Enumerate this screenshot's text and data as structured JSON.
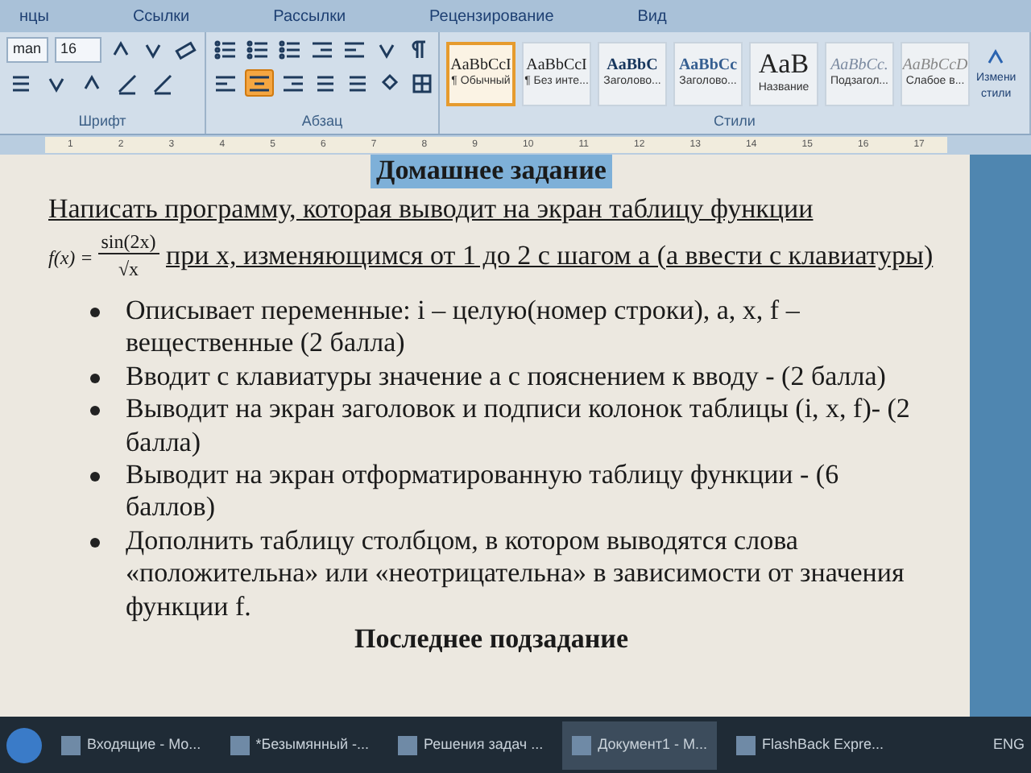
{
  "ribbon_tabs": [
    {
      "label": "нцы",
      "selected": false
    },
    {
      "label": "Ссылки",
      "selected": false
    },
    {
      "label": "Рассылки",
      "selected": false
    },
    {
      "label": "Рецензирование",
      "selected": false
    },
    {
      "label": "Вид",
      "selected": false
    }
  ],
  "font_group": {
    "font_name": "man",
    "font_size": "16",
    "label": "Шрифт"
  },
  "paragraph_group": {
    "label": "Абзац",
    "alignment_buttons": [
      {
        "selected": false
      },
      {
        "selected": true
      },
      {
        "selected": false
      },
      {
        "selected": false
      }
    ]
  },
  "styles_group": {
    "label": "Стили",
    "styles": [
      {
        "sample": "AaBbCcI",
        "name": "¶ Обычный",
        "selected": true,
        "kind": "normal"
      },
      {
        "sample": "AaBbCcI",
        "name": "¶ Без инте...",
        "selected": false,
        "kind": "normal"
      },
      {
        "sample": "AaBbC",
        "name": "Заголово...",
        "selected": false,
        "kind": "heading1"
      },
      {
        "sample": "AaBbCc",
        "name": "Заголово...",
        "selected": false,
        "kind": "heading2"
      },
      {
        "sample": "AaB",
        "name": "Название",
        "selected": false,
        "kind": "title"
      },
      {
        "sample": "AaBbCc.",
        "name": "Подзагол...",
        "selected": false,
        "kind": "subtitle"
      },
      {
        "sample": "AaBbCcD",
        "name": "Слабое в...",
        "selected": false,
        "kind": "subtle"
      }
    ],
    "change_styles": [
      "Измени",
      "стили"
    ]
  },
  "ruler": {
    "numbers": [
      "1",
      "2",
      "3",
      "4",
      "5",
      "6",
      "7",
      "8",
      "9",
      "10",
      "11",
      "12",
      "13",
      "14",
      "15",
      "16",
      "17"
    ]
  },
  "document": {
    "title": "Домашнее задание",
    "task": {
      "text": "Написать программу, которая выводит на экран  таблицу  функции",
      "underlined": true
    },
    "formula": {
      "lhs": "f(x) =",
      "numerator": "sin(2x)",
      "denominator": "√x"
    },
    "task_rest": "при x, изменяющимся от 1 до 2 с шагом a (а ввести с клавиатуры)",
    "bullets": [
      "Описывает переменные:  i – целую(номер строки),  a, x, f – вещественные  (2 балла)",
      "Вводит с клавиатуры значение a  с пояснением к вводу - (2 балла)",
      "Выводит на экран заголовок и подписи колонок таблицы (i, x, f)- (2 балла)",
      "Выводит на экран отформатированную таблицу функции  - (6 баллов)",
      "Дополнить таблицу столбцом, в котором выводятся слова «положительна» или «неотрицательна» в зависимости от значения функции f."
    ],
    "subheading": "Последнее подзадание"
  },
  "taskbar": {
    "items": [
      {
        "label": "Входящие - Mo...",
        "selected": false
      },
      {
        "label": "*Безымянный -...",
        "selected": false
      },
      {
        "label": "Решения задач ...",
        "selected": false
      },
      {
        "label": "Документ1 - M...",
        "selected": true
      },
      {
        "label": "FlashBack Expre...",
        "selected": false
      }
    ],
    "language": "ENG"
  }
}
